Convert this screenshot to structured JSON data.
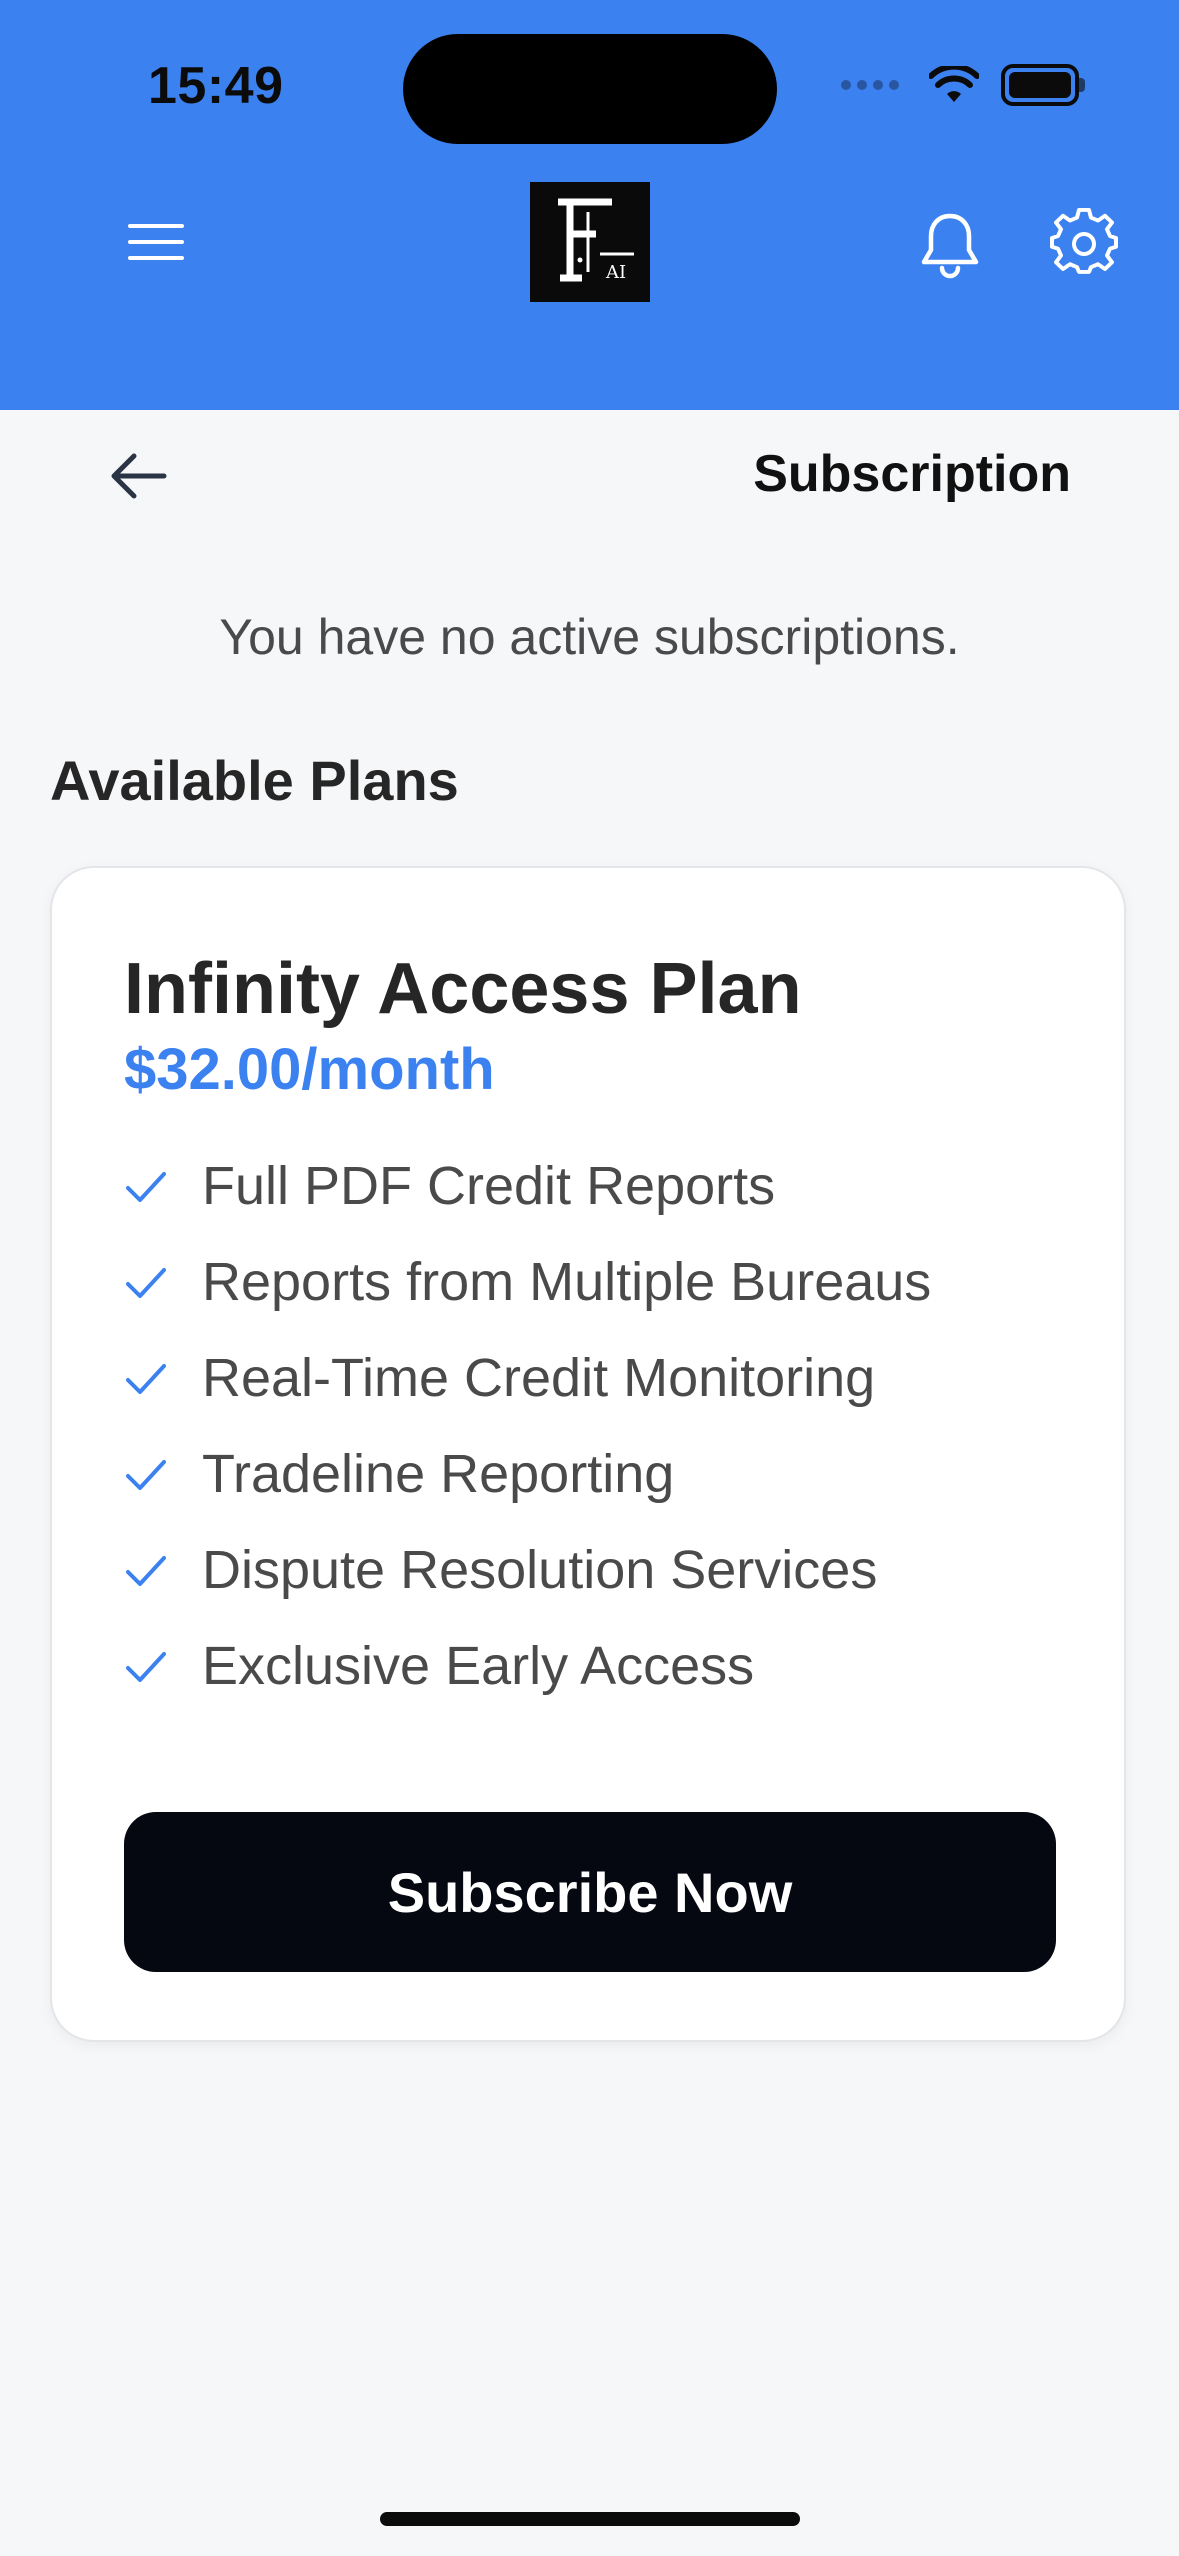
{
  "status_bar": {
    "time": "15:49"
  },
  "header": {
    "logo_text": "AI",
    "menu_icon": "hamburger-icon",
    "notification_icon": "bell-icon",
    "settings_icon": "gear-icon",
    "accent_color": "#3b82f0"
  },
  "page": {
    "back_icon": "arrow-left-icon",
    "title": "Subscription",
    "empty_message": "You have no active subscriptions.",
    "section_title": "Available Plans"
  },
  "plan": {
    "name": "Infinity Access Plan",
    "price": "$32.00/month",
    "features": [
      "Full PDF Credit Reports",
      "Reports from Multiple Bureaus",
      "Real-Time Credit Monitoring",
      "Tradeline Reporting",
      "Dispute Resolution Services",
      "Exclusive Early Access"
    ],
    "cta_label": "Subscribe Now"
  }
}
